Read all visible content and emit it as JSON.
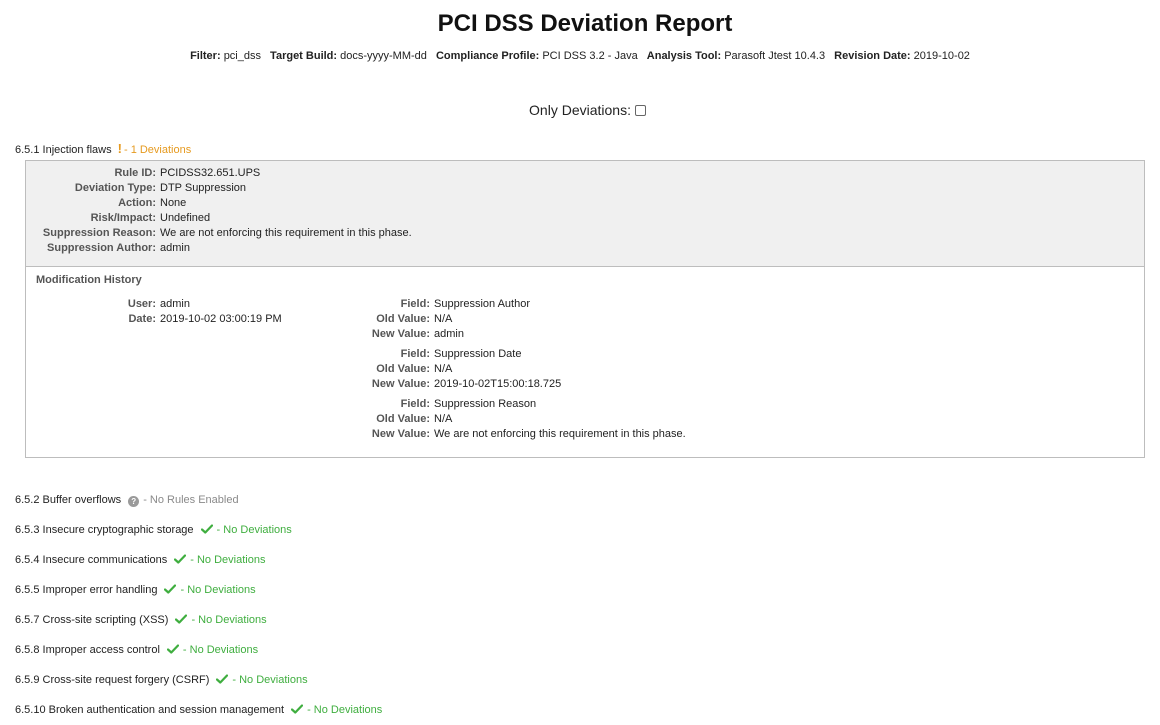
{
  "title": "PCI DSS Deviation Report",
  "meta": [
    {
      "label": "Filter:",
      "value": "pci_dss"
    },
    {
      "label": "Target Build:",
      "value": "docs-yyyy-MM-dd"
    },
    {
      "label": "Compliance Profile:",
      "value": "PCI DSS 3.2 - Java"
    },
    {
      "label": "Analysis Tool:",
      "value": "Parasoft Jtest 10.4.3"
    },
    {
      "label": "Revision Date:",
      "value": "2019-10-02"
    }
  ],
  "only_deviations_label": "Only Deviations:",
  "only_deviations_checked": false,
  "colors": {
    "warning": "#e69a1f",
    "ok": "#3fae3f",
    "neutral": "#8a8a8a",
    "panel_bg": "#f0f0f0"
  },
  "sections": [
    {
      "title": "6.5.1 Injection flaws",
      "status": "- 1 Deviations",
      "icon": "exclamation-icon"
    },
    {
      "title": "6.5.2 Buffer overflows",
      "status": "- No Rules Enabled",
      "icon": "question-icon"
    },
    {
      "title": "6.5.3 Insecure cryptographic storage",
      "status": "- No Deviations",
      "icon": "check-icon"
    },
    {
      "title": "6.5.4 Insecure communications",
      "status": "- No Deviations",
      "icon": "check-icon"
    },
    {
      "title": "6.5.5 Improper error handling",
      "status": "- No Deviations",
      "icon": "check-icon"
    },
    {
      "title": "6.5.7 Cross-site scripting (XSS)",
      "status": "- No Deviations",
      "icon": "check-icon"
    },
    {
      "title": "6.5.8 Improper access control",
      "status": "- No Deviations",
      "icon": "check-icon"
    },
    {
      "title": "6.5.9 Cross-site request forgery (CSRF)",
      "status": "- No Deviations",
      "icon": "check-icon"
    },
    {
      "title": "6.5.10 Broken authentication and session management",
      "status": "- No Deviations",
      "icon": "check-icon"
    }
  ],
  "deviation": {
    "details": [
      {
        "label": "Rule ID:",
        "value": "PCIDSS32.651.UPS"
      },
      {
        "label": "Deviation Type:",
        "value": "DTP Suppression"
      },
      {
        "label": "Action:",
        "value": "None"
      },
      {
        "label": "Risk/Impact:",
        "value": "Undefined"
      },
      {
        "label": "Suppression Reason:",
        "value": "We are not enforcing this requirement in this phase."
      },
      {
        "label": "Suppression Author:",
        "value": "admin"
      }
    ],
    "history_title": "Modification History",
    "history_meta": [
      {
        "label": "User:",
        "value": "admin"
      },
      {
        "label": "Date:",
        "value": "2019-10-02 03:00:19 PM"
      }
    ],
    "changes": [
      {
        "field_label": "Field:",
        "field": "Suppression Author",
        "old_label": "Old Value:",
        "old": "N/A",
        "new_label": "New Value:",
        "new": "admin"
      },
      {
        "field_label": "Field:",
        "field": "Suppression Date",
        "old_label": "Old Value:",
        "old": "N/A",
        "new_label": "New Value:",
        "new": "2019-10-02T15:00:18.725"
      },
      {
        "field_label": "Field:",
        "field": "Suppression Reason",
        "old_label": "Old Value:",
        "old": "N/A",
        "new_label": "New Value:",
        "new": "We are not enforcing this requirement in this phase."
      }
    ]
  }
}
